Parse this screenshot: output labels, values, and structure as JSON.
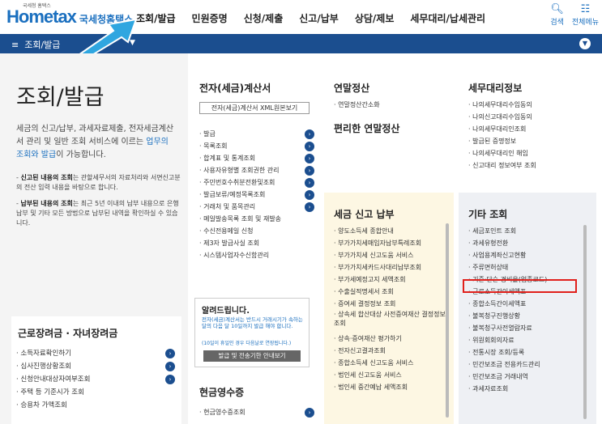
{
  "brand": {
    "name": "Hometax",
    "small": "국세청 홈택스",
    "korean": "국세청홈택스"
  },
  "gnb": [
    "조회/발급",
    "민원증명",
    "신청/제출",
    "신고/납부",
    "상담/제보",
    "세무대리/납세관리"
  ],
  "util": [
    {
      "icon": "search-icon",
      "label": "검색"
    },
    {
      "icon": "grid-icon",
      "label": "전체메뉴"
    }
  ],
  "navbar": {
    "menu_icon": "≡",
    "crumb": "조회/발급"
  },
  "left": {
    "title": "조회/발급",
    "intro_pre": "세금의 신고/납부, 과세자료제출, 전자세금계산서 관리 및 일반 조회 서비스에 이르는 ",
    "intro_hl": "업무의 조회와 발급",
    "intro_post": "이 가능합니다.",
    "note1_b": "신고된 내용의 조회",
    "note1": "는 관할세무서의 자료처리와 서면신고분의 전산 입력 내용을 바탕으로 합니다.",
    "note2_b": "납부된 내용의 조회",
    "note2": "는 최근 5년 이내의 납부 내용으로 은행 납부 및 기타 모든 방법으로 납부된 내역을 확인하실 수 있습니다.",
    "box_title": "근로장려금 · 자녀장려금",
    "box_items": [
      "소득자료확인하기",
      "심사진행상황조회",
      "신청안내대상자여부조회",
      "주택 등 기준시가 조회",
      "승용차 가액조회"
    ]
  },
  "col1": {
    "title": "전자(세금)계산서",
    "btn": "전자(세금)계산서 XML원본보기",
    "items": [
      "발급",
      "목록조회",
      "합계표 및 통계조회",
      "사용자유형별 조회권한 관리",
      "주민번호수취분전환및조회",
      "발급보류/예정목록조회",
      "거래처 및 품목관리",
      "메일발송목록 조회 및 재발송",
      "수신전용메일 신청",
      "제3자 발급사실 조회",
      "시스템사업자수신함관리"
    ],
    "alert_title": "알려드립니다.",
    "alert_body": "전자(세금)계산서는 반드시 거래시기가 속하는 달의 다음 달 10일까지 발급 해야 합니다.",
    "alert_sub": "(10일이 휴일인 경우 다음날로 연장됩니다.)",
    "alert_btn": "발급 및 전송기한 안내보기",
    "cash_title": "현금영수증",
    "cash_items": [
      "현금영수증조회"
    ]
  },
  "col2": {
    "title": "연말정산",
    "items": [
      "연말정산간소화"
    ],
    "sub": "편리한 연말정산",
    "title2": "세금 신고 납부",
    "items2": [
      "양도소득세 종합안내",
      "부가가치세매입자납부특례조회",
      "부가가치세 신고도움 서비스",
      "부가가치세카드사대리납부조회",
      "부가세예정고지 세액조회",
      "수출실적명세서 조회",
      "증여세 결정정보 조회",
      "상속세 합산대상 사전증여재산 결정정보 조회",
      "상속·증여재산 평가하기",
      "전자신고결과조회",
      "종합소득세 신고도움 서비스",
      "법인세 신고도움 서비스",
      "법인세 중간예납 세액조회"
    ]
  },
  "col3": {
    "title": "세무대리정보",
    "items": [
      "나의세무대리수임동의",
      "나의신고대리수임동의",
      "나의세무대리인조회",
      "발급된 증명정보",
      "나의세무대리인 해임",
      "신고대리 정보여부 조회"
    ],
    "title2": "기타 조회",
    "items2": [
      "세금포인트 조회",
      "과세유형전환",
      "사업용계좌신고현황",
      "주류면허상태",
      "기준·단순 경비율(업종코드)",
      "근로소득간이세액표",
      "종합소득간이세액표",
      "불복청구진행상황",
      "불복청구사전열람자료",
      "위원회회의자료",
      "전통시장 조회/등록",
      "민간보조금 전용카드관리",
      "민간보조금 거래내역",
      "과세자료조회"
    ]
  },
  "colors": {
    "navy": "#1b4e8f",
    "blue": "#1a6fbf",
    "highlight": "#e0201b",
    "yellow": "#fdf7e3"
  }
}
